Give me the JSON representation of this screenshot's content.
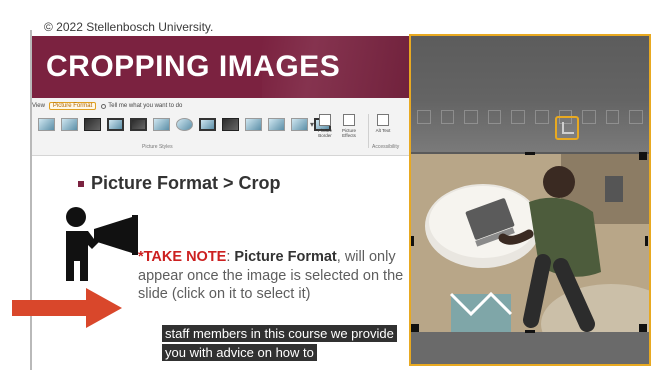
{
  "slide": {
    "copyright": "© 2022 Stellenbosch University.",
    "banner_title": "CROPPING IMAGES",
    "bullet": "Picture Format > Crop",
    "note": {
      "take_note": "*TAKE NOTE",
      "separator": ": ",
      "picture_format": "Picture Format",
      "rest": ", will only appear once the image is selected on the slide (click on it to select it)"
    }
  },
  "ribbon": {
    "tab_view": "View",
    "tab_picture_format": "Picture Format",
    "tell_me": "Tell me what you want to do",
    "group_picture_styles": "Picture Styles",
    "group_accessibility": "Accessibility",
    "btn_picture_border": "Picture Border",
    "btn_picture_effects": "Picture Effects",
    "btn_alt_text": "Alt Text"
  },
  "captions": {
    "line1": "staff members in this course we provide",
    "line2": "you with advice on how to"
  },
  "colors": {
    "brand_maroon": "#7b2240",
    "highlight_orange": "#e8a921",
    "arrow_red": "#d9472b"
  }
}
